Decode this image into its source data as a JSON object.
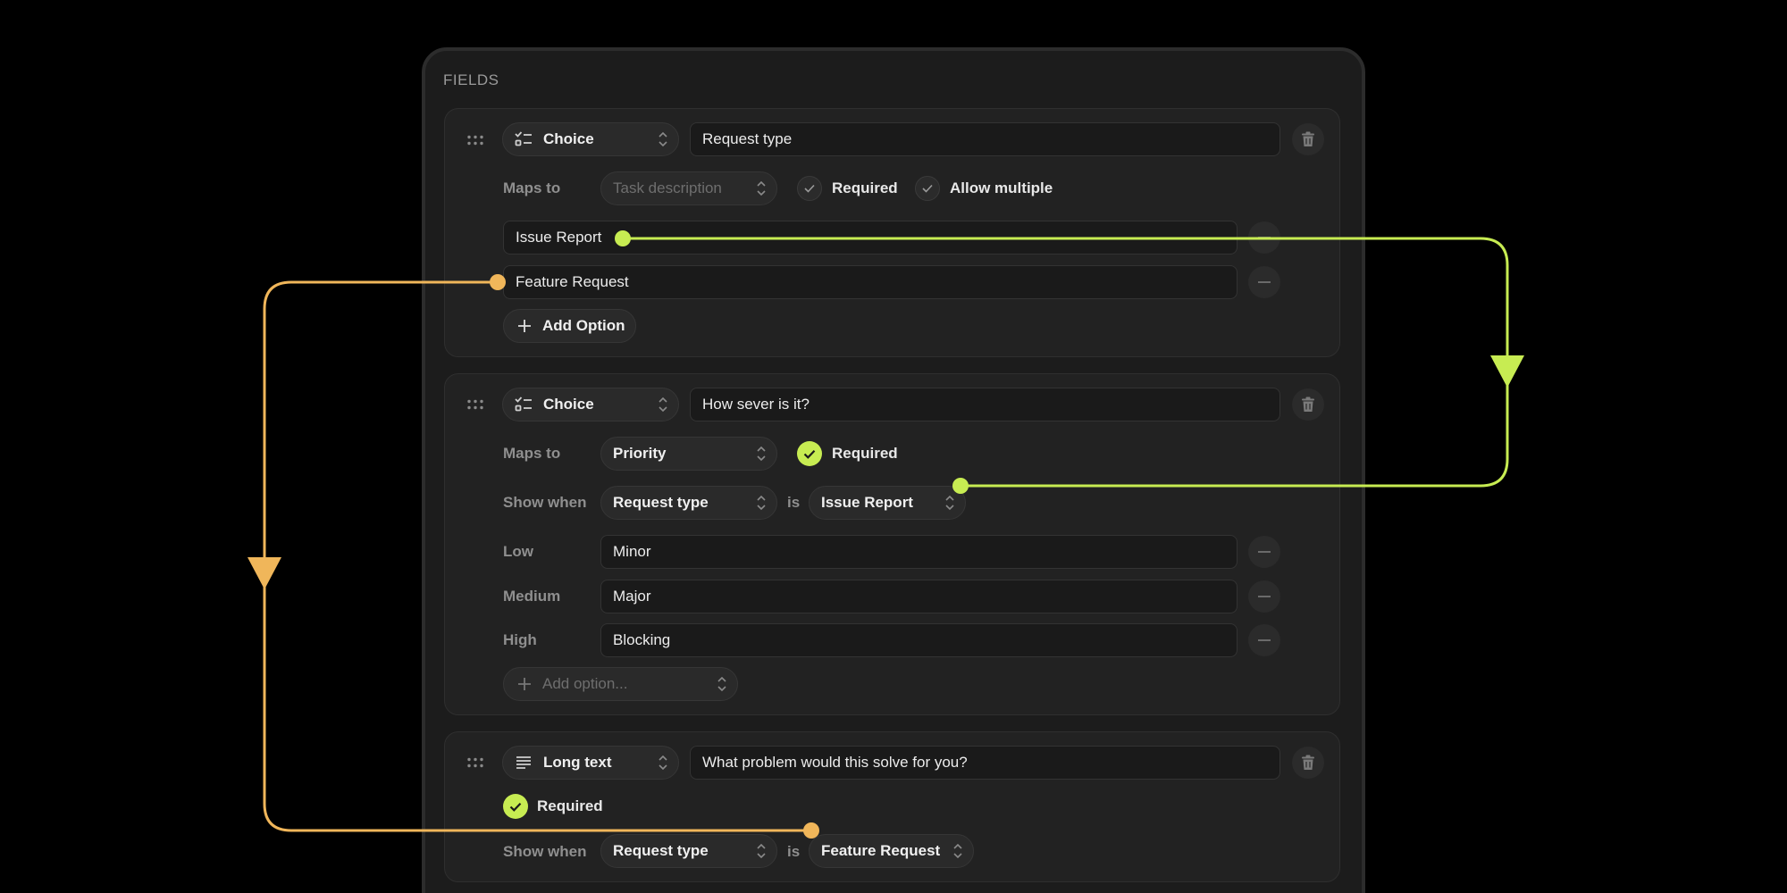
{
  "panel": {
    "title": "FIELDS"
  },
  "colors": {
    "green": "#c7ec52",
    "orange": "#f0b65a",
    "background": "#000000",
    "panel": "#1c1c1c"
  },
  "fields": [
    {
      "type": "Choice",
      "type_icon": "checklist-icon",
      "question": "Request type",
      "maps_to_label": "Maps to",
      "maps_to_value": "Task description",
      "required_label": "Required",
      "allow_multiple_label": "Allow multiple",
      "options": [
        "Issue Report",
        "Feature Request"
      ],
      "add_option_label": "Add Option"
    },
    {
      "type": "Choice",
      "type_icon": "checklist-icon",
      "question": "How sever is it?",
      "maps_to_label": "Maps to",
      "maps_to_value": "Priority",
      "required_label": "Required",
      "show_when_label": "Show when",
      "show_when_field": "Request type",
      "is_label": "is",
      "show_when_value": "Issue Report",
      "options": [
        {
          "label": "Low",
          "value": "Minor"
        },
        {
          "label": "Medium",
          "value": "Major"
        },
        {
          "label": "High",
          "value": "Blocking"
        }
      ],
      "add_option_placeholder": "Add option..."
    },
    {
      "type": "Long text",
      "type_icon": "paragraph-icon",
      "question": "What problem would this solve for you?",
      "required_label": "Required",
      "show_when_label": "Show when",
      "show_when_field": "Request type",
      "is_label": "is",
      "show_when_value": "Feature Request"
    }
  ]
}
